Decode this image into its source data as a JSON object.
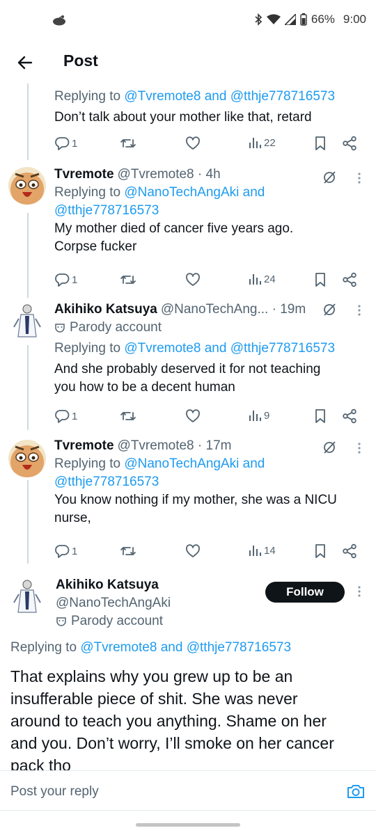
{
  "status_bar": {
    "battery": "66%",
    "time": "9:00"
  },
  "header": {
    "title": "Post"
  },
  "tweets": [
    {
      "reply_prefix": "Replying to",
      "mention1": "@Tvremote8",
      "conj": "and",
      "mention2": "@tthje778716573",
      "text": "Don’t talk about your mother like that, retard",
      "replies": "1",
      "views": "22"
    },
    {
      "name": "Tvremote",
      "handle": "@Tvremote8 · 4h",
      "reply_prefix": "Replying to",
      "mention1": "@NanoTechAngAki",
      "conj": "and",
      "mention2": "@tthje778716573",
      "text_line1": "My mother died of cancer five years ago.",
      "text_line2": "Corpse fucker",
      "replies": "1",
      "views": "24"
    },
    {
      "name": "Akihiko Katsuya",
      "handle": "@NanoTechAng... · 19m",
      "parody": "Parody account",
      "reply_prefix": "Replying to",
      "mention1": "@Tvremote8",
      "conj": "and",
      "mention2": "@tthje778716573",
      "text_line1": "And she probably deserved it for not teaching",
      "text_line2": "you how to be a decent human",
      "replies": "1",
      "views": "9"
    },
    {
      "name": "Tvremote",
      "handle": "@Tvremote8 · 17m",
      "reply_prefix": "Replying to",
      "mention1": "@NanoTechAngAki",
      "conj": "and",
      "mention2": "@tthje778716573",
      "text_line1": "You know nothing if my mother, she was a NICU",
      "text_line2": "nurse,",
      "replies": "1",
      "views": "14"
    }
  ],
  "main_tweet": {
    "name": "Akihiko Katsuya",
    "handle": "@NanoTechAngAki",
    "parody": "Parody account",
    "follow_label": "Follow",
    "reply_prefix": "Replying to",
    "mention1": "@Tvremote8",
    "conj": "and",
    "mention2": "@tthje778716573",
    "line1": "That explains why you grew up to be an",
    "line2": "insufferable piece of shit. She was never",
    "line3": "around to teach you anything. Shame on her",
    "line4": "and you. Don’t worry, I’ll smoke on her cancer",
    "line5": "pack tho"
  },
  "reply_bar": {
    "placeholder": "Post your reply"
  },
  "icons": {
    "back": "arrow-left-icon",
    "reply": "comment-icon",
    "repost": "repost-icon",
    "like": "heart-icon",
    "views": "bar-chart-icon",
    "bookmark": "bookmark-icon",
    "share": "share-icon",
    "camera": "camera-icon"
  },
  "colors": {
    "link": "#1d9bf0",
    "secondary": "#536471",
    "follow_bg": "#0f1419"
  }
}
